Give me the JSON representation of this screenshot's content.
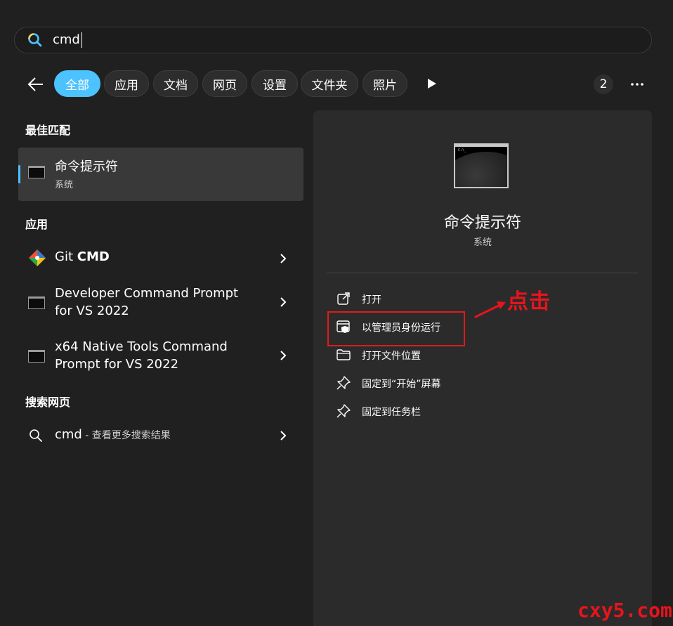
{
  "search": {
    "query": "cmd"
  },
  "filters": {
    "tabs": [
      "全部",
      "应用",
      "文档",
      "网页",
      "设置",
      "文件夹",
      "照片"
    ],
    "active_index": 0,
    "count_badge": "2"
  },
  "sections": {
    "best_match": "最佳匹配",
    "apps": "应用",
    "web": "搜索网页"
  },
  "best_match": {
    "title": "命令提示符",
    "subtitle": "系统"
  },
  "apps": [
    {
      "name_plain": "Git ",
      "name_bold": "CMD",
      "icon": "git-icon"
    },
    {
      "line1": "Developer Command Prompt",
      "line2": "for VS 2022",
      "icon": "console-icon"
    },
    {
      "line1": "x64 Native Tools Command",
      "line2": "Prompt for VS 2022",
      "icon": "console-icon"
    }
  ],
  "web_result": {
    "query": "cmd",
    "suffix": " - 查看更多搜索结果"
  },
  "detail": {
    "title": "命令提示符",
    "subtitle": "系统",
    "actions": [
      {
        "label": "打开",
        "icon": "open-external-icon"
      },
      {
        "label": "以管理员身份运行",
        "icon": "shield-window-icon"
      },
      {
        "label": "打开文件位置",
        "icon": "folder-icon"
      },
      {
        "label": "固定到“开始”屏幕",
        "icon": "pin-icon"
      },
      {
        "label": "固定到任务栏",
        "icon": "pin-icon"
      }
    ]
  },
  "annotation": {
    "text": "点击",
    "color": "#e8141c"
  },
  "watermark": "cxy5.com",
  "colors": {
    "accent": "#4cc2ff",
    "background": "#202020",
    "panel": "#2b2b2b"
  }
}
